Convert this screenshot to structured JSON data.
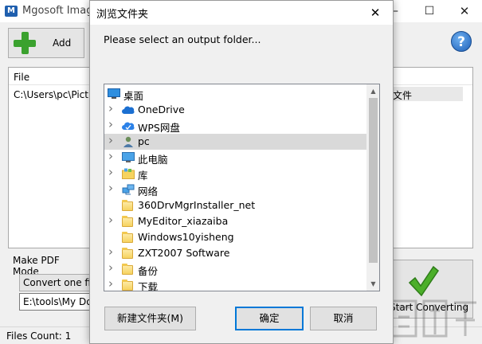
{
  "app": {
    "title": "Mgosoft Image",
    "add_label": "Add",
    "help_label": "?",
    "file_col_header": "File",
    "type_col_fragment": "文件",
    "file_path": "C:\\Users\\pc\\Picture",
    "mode_group_label": "Make PDF Mode",
    "mode_value": "Convert one file t",
    "output_path": "E:\\tools\\My Doc\\",
    "start_label": "Start Converting",
    "status": "Files Count: 1"
  },
  "dialog": {
    "title": "浏览文件夹",
    "prompt": "Please select an output folder...",
    "tree": [
      {
        "label": "桌面",
        "icon": "desktop-icon",
        "indent": 0,
        "expandable": false,
        "selected": false
      },
      {
        "label": "OneDrive",
        "icon": "onedrive-cloud-icon",
        "indent": 1,
        "expandable": true,
        "selected": false
      },
      {
        "label": "WPS网盘",
        "icon": "wps-cloud-icon",
        "indent": 1,
        "expandable": true,
        "selected": false
      },
      {
        "label": "pc",
        "icon": "user-icon",
        "indent": 1,
        "expandable": true,
        "selected": true
      },
      {
        "label": "此电脑",
        "icon": "computer-icon",
        "indent": 1,
        "expandable": true,
        "selected": false
      },
      {
        "label": "库",
        "icon": "library-icon",
        "indent": 1,
        "expandable": true,
        "selected": false
      },
      {
        "label": "网络",
        "icon": "network-icon",
        "indent": 1,
        "expandable": true,
        "selected": false
      },
      {
        "label": "360DrvMgrInstaller_net",
        "icon": "folder-icon",
        "indent": 1,
        "expandable": false,
        "selected": false
      },
      {
        "label": "MyEditor_xiazaiba",
        "icon": "folder-icon",
        "indent": 1,
        "expandable": true,
        "selected": false
      },
      {
        "label": "Windows10yisheng",
        "icon": "folder-icon",
        "indent": 1,
        "expandable": false,
        "selected": false
      },
      {
        "label": "ZXT2007 Software",
        "icon": "folder-icon",
        "indent": 1,
        "expandable": true,
        "selected": false
      },
      {
        "label": "备份",
        "icon": "folder-icon",
        "indent": 1,
        "expandable": true,
        "selected": false
      },
      {
        "label": "下载",
        "icon": "folder-icon",
        "indent": 1,
        "expandable": true,
        "selected": false
      }
    ],
    "buttons": {
      "new_folder": "新建文件夹(M)",
      "ok": "确定",
      "cancel": "取消"
    }
  },
  "colors": {
    "accent": "#0078d7",
    "selection": "#d9d9d9",
    "add_green": "#3aa12e",
    "check_green": "#4caf2a"
  }
}
